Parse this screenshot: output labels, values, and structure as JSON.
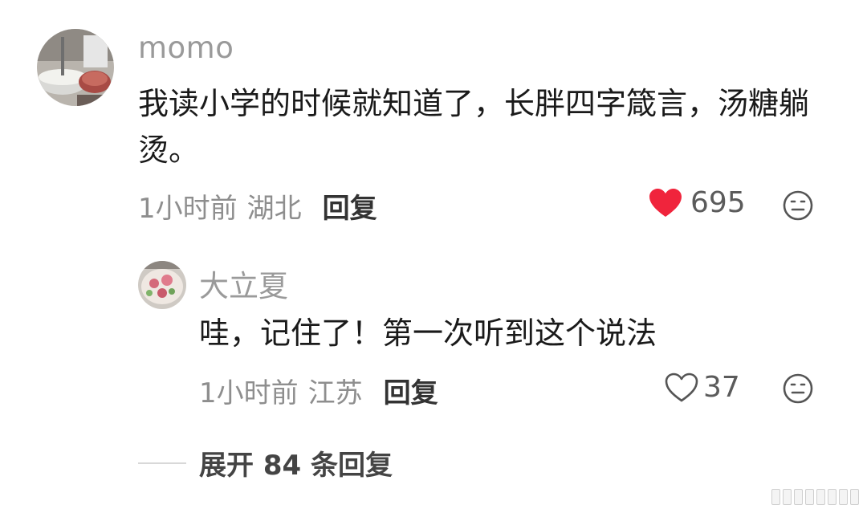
{
  "comment": {
    "username": "momo",
    "text": "我读小学的时候就知道了，长胖四字箴言，汤糖躺烫。",
    "time": "1小时前",
    "location": "湖北",
    "reply_label": "回复",
    "likes": "695",
    "liked": true,
    "colors": {
      "like_active": "#f0243c"
    }
  },
  "reply": {
    "username": "大立夏",
    "text": "哇，记住了！第一次听到这个说法",
    "time": "1小时前",
    "location": "江苏",
    "reply_label": "回复",
    "likes": "37",
    "liked": false
  },
  "expand": {
    "label": "展开 84 条回复"
  }
}
